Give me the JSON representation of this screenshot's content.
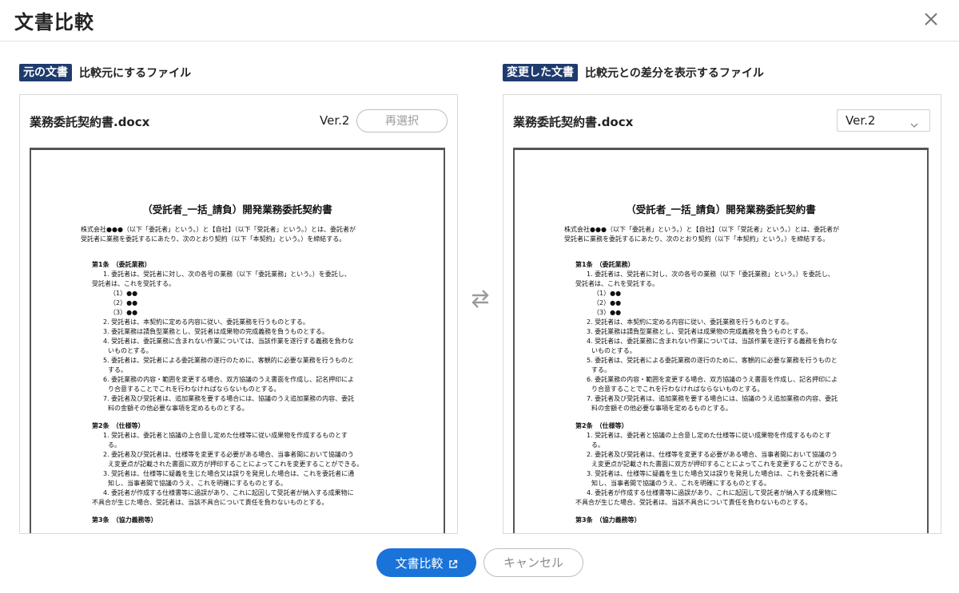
{
  "dialog": {
    "title": "文書比較",
    "close_icon": "close-icon"
  },
  "colors": {
    "badge_bg": "#1f3b6e",
    "primary_button": "#1a73d9",
    "document_border": "#555555"
  },
  "original": {
    "badge": "元の文書",
    "description": "比較元にするファイル",
    "filename": "業務委託契約書.docx",
    "version": "Ver.2",
    "reselect_label": "再選択"
  },
  "changed": {
    "badge": "変更した文書",
    "description": "比較元との差分を表示するファイル",
    "filename": "業務委託契約書.docx",
    "version_selected": "Ver.2"
  },
  "swap_icon": "swap-arrows-icon",
  "document": {
    "title": "（受託者_一括_請負）開発業務委託契約書",
    "lines": [
      "株式会社●●●（以下「委託者」という。）と【自社】（以下「受託者」という。）とは、委託者が",
      "受託者に業務を委託するにあたり、次のとおり契約（以下「本契約」という。）を締結する。",
      "第1条　（委託業務）",
      "1. 委託者は、受託者に対し、次の各号の業務（以下「委託業務」という。）を委託し、",
      "受託者は、これを受託する。",
      "（1）●●",
      "（2）●●",
      "（3）●●",
      "2. 受託者は、本契約に定める内容に従い、委託業務を行うものとする。",
      "3. 委託業務は請負型業務とし、受託者は成果物の完成義務を負うものとする。",
      "4. 受託者は、委託業務に含まれない作業については、当該作業を遂行する義務を負わな",
      "いものとする。",
      "5. 委託者は、受託者による委託業務の遂行のために、客観的に必要な業務を行うものと",
      "する。",
      "6. 委託業務の内容・範囲を変更する場合、双方協議のうえ書面を作成し、記名押印によ",
      "り合意することでこれを行わなければならないものとする。",
      "7. 委託者及び受託者は、追加業務を要する場合には、協議のうえ追加業務の内容、委託",
      "料の金額その他必要な事項を定めるものとする。",
      "第2条　（仕様等）",
      "1. 受託者は、委託者と協議の上合意し定めた仕様等に従い成果物を作成するものとす",
      "る。",
      "2. 委託者及び受託者は、仕様等を変更する必要がある場合、当事者間において協議のう",
      "え変更点が記載された書面に双方が押印することによってこれを変更することができる。",
      "3. 受託者は、仕様等に疑義を生じた場合又は誤りを発見した場合は、これを委託者に通",
      "知し、当事者間で協議のうえ、これを明確にするものとする。",
      "4. 委託者が作成する仕様書等に過誤があり、これに起因して受託者が納入する成果物に",
      "不具合が生じた場合、受託者は、当該不具合について責任を負わないものとする。",
      "第3条　（協力義務等）"
    ]
  },
  "actions": {
    "compare_label": "文書比較",
    "compare_icon": "external-link-icon",
    "cancel_label": "キャンセル"
  }
}
